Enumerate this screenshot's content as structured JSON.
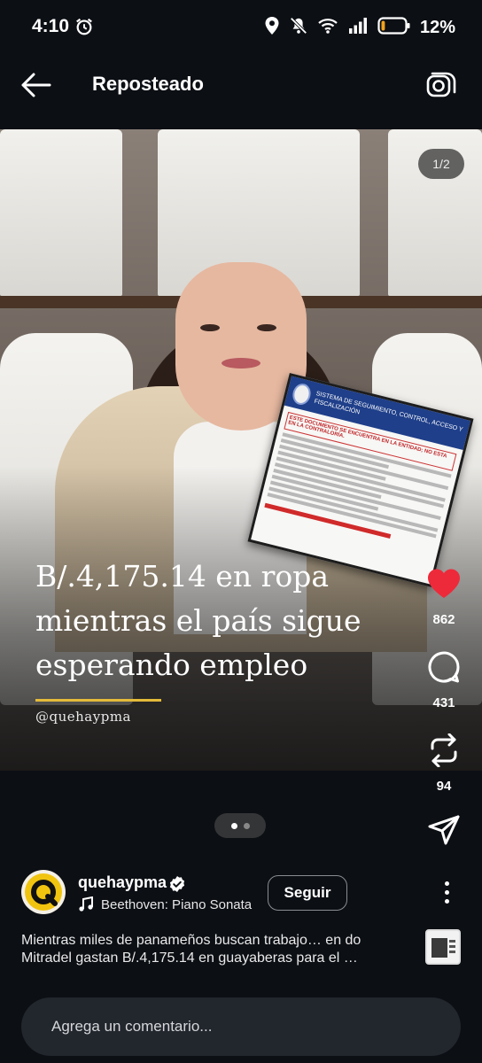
{
  "status_bar": {
    "time": "4:10",
    "battery_text": "12%",
    "battery_level": 0.12,
    "icons": [
      "alarm-icon",
      "location-icon",
      "mute-icon",
      "wifi-icon",
      "signal-icon",
      "battery-icon"
    ]
  },
  "header": {
    "title": "Reposteado",
    "back_icon": "arrow-left-icon",
    "camera_icon": "camera-icon"
  },
  "post": {
    "page_counter": "1/2",
    "headline": "B/.4,175.14 en ropa mientras el país sigue esperando empleo",
    "handle": "@quehaypma",
    "document": {
      "header_text": "SISTEMA DE SEGUIMIENTO, CONTROL, ACCESO Y FISCALIZACIÓN",
      "alert_text": "ESTE DOCUMENTO SE ENCUENTRA EN LA ENTIDAD; NO ESTA EN LA CONTRALORÍA."
    },
    "carousel": {
      "total": 2,
      "active": 1
    }
  },
  "actions": {
    "like_count": "862",
    "comment_count": "431",
    "repost_count": "94",
    "like_color": "#ed2a3a"
  },
  "author": {
    "username": "quehaypma",
    "verified": true,
    "music": "Beethoven: Piano Sonata",
    "follow_label": "Seguir"
  },
  "caption": {
    "text": "Mientras miles de panameños buscan trabajo… en do Mitradel gastan B/.4,175.14 en guayaberas para el …"
  },
  "comment": {
    "placeholder": "Agrega un comentario..."
  }
}
